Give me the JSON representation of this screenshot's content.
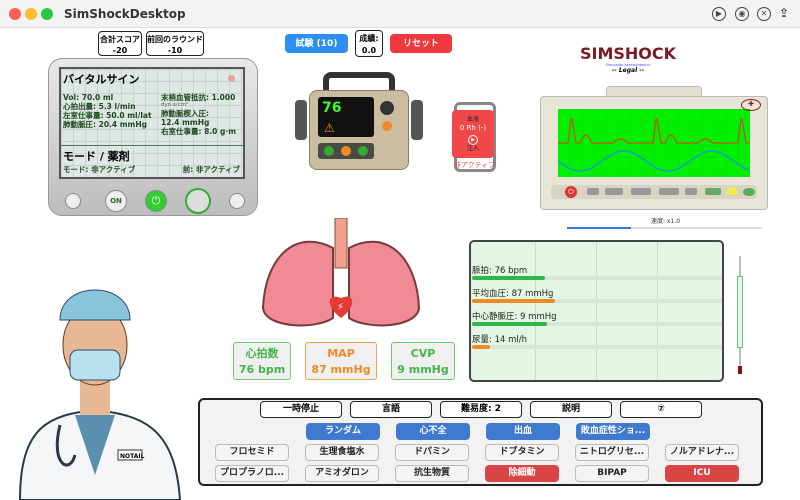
{
  "window": {
    "title": "SimShockDesktop"
  },
  "scores": {
    "total_label": "合計スコア",
    "total_value": "-20",
    "last_label": "前回のラウンド",
    "last_value": "-10"
  },
  "top_buttons": {
    "exam": "試験 (10)",
    "grade_label": "成績:",
    "grade_value": "0.0",
    "reset": "リセット"
  },
  "vitals_monitor": {
    "title": "バイタルサイン",
    "left": [
      "Vol: 70.0 ml",
      "心拍出量: 5.3 l/min",
      "左室仕事量: 50.0 ml/lat",
      "肺動脈圧: 20.4 mmHg"
    ],
    "svr": "末梢血管抵抗: 1.000",
    "svr_unit": "dyn·s/cm⁵",
    "pcwp_label": "肺動脈楔入圧:",
    "pcwp_value": "12.4 mmHg",
    "rv_work": "右室仕事量: 8.0 g·m",
    "mode_title": "モード / 薬剤",
    "mode": "モード: 非アクティブ",
    "prev": "前: 非アクティブ",
    "on_label": "ON"
  },
  "defibrillator": {
    "display": "76"
  },
  "blood_bag": {
    "label": "血液",
    "type": "0 Rh (-)",
    "inject": "注入",
    "status": "非アクティブ"
  },
  "brand": {
    "name": "SIMSHOCK",
    "subtitle": "Simulador hemodinámico",
    "edition": "-- Legal --"
  },
  "ecg_monitor": {
    "speed": "速度: x1.0",
    "speed_fraction": 0.33
  },
  "vital_boxes": [
    {
      "label": "心拍数",
      "value": "76 bpm",
      "color": "#3fb54a"
    },
    {
      "label": "MAP",
      "value": "87 mmHg",
      "color": "#f08a24"
    },
    {
      "label": "CVP",
      "value": "9 mmHg",
      "color": "#3fb54a"
    }
  ],
  "metrics": [
    {
      "label": "脈拍: 76 bpm",
      "fraction": 0.29,
      "color": "#2fb84a"
    },
    {
      "label": "平均血圧: 87 mmHg",
      "fraction": 0.33,
      "color": "#f08a24"
    },
    {
      "label": "中心静脈圧: 9 mmHg",
      "fraction": 0.3,
      "color": "#2fb84a"
    },
    {
      "label": "尿量: 14 ml/h",
      "fraction": 0.07,
      "color": "#f08a24"
    }
  ],
  "doctor": {
    "badge": "NOTAIL"
  },
  "controls": {
    "top": [
      "一時停止",
      "言語",
      "難易度: 2",
      "説明",
      "⑦"
    ],
    "scenarios": [
      "ランダム",
      "心不全",
      "出血",
      "敗血症性ショ..."
    ],
    "drugs1": [
      "フロセミド",
      "生理食塩水",
      "ドパミン",
      "ドブタミン",
      "ニトログリセ...",
      "ノルアドレナ..."
    ],
    "drugs2": [
      "プロプラノロ...",
      "アミオダロン",
      "抗生物質",
      "除細動",
      "BIPAP",
      "ICU"
    ]
  }
}
